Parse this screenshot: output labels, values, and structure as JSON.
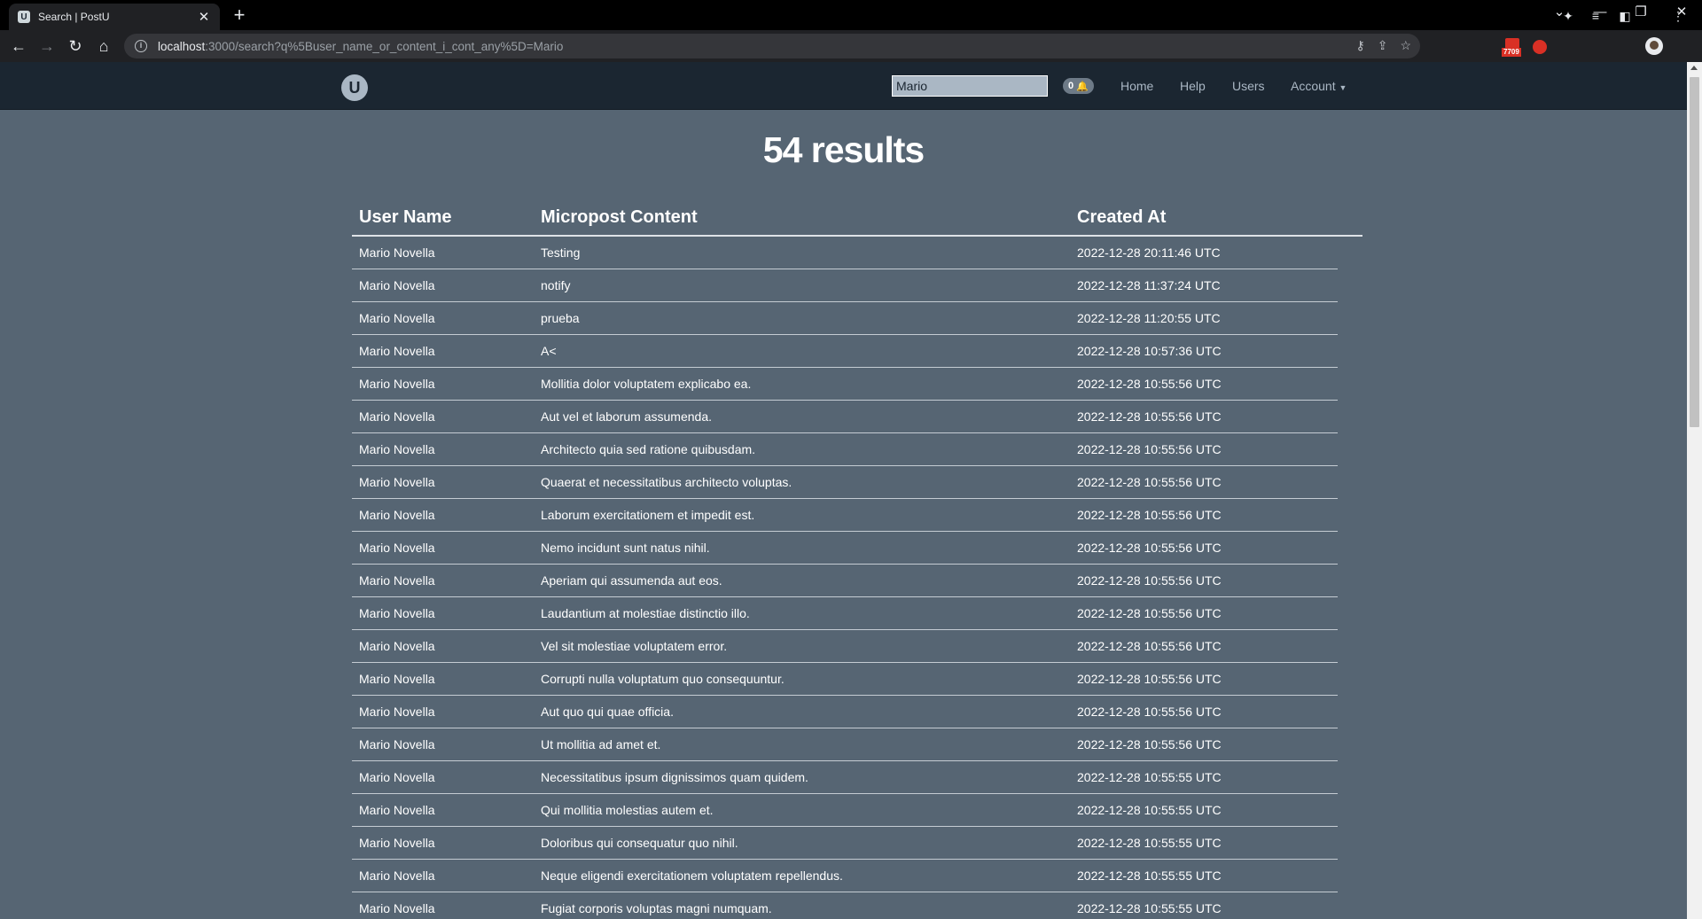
{
  "browser": {
    "tab_title": "Search | PostU",
    "tab_favicon": "U",
    "new_tab_symbol": "+",
    "url_host": "localhost",
    "url_rest": ":3000/search?q%5Buser_name_or_content_i_cont_any%5D=Mario",
    "extension_badge_count": "7709"
  },
  "navbar": {
    "logo_letter": "U",
    "search_value": "Mario",
    "notification_count": "0",
    "links": [
      "Home",
      "Help",
      "Users",
      "Account"
    ]
  },
  "results": {
    "title": "54 results",
    "headers": [
      "User Name",
      "Micropost Content",
      "Created At"
    ],
    "rows": [
      {
        "user": "Mario Novella",
        "content": "Testing",
        "created": "2022-12-28 20:11:46 UTC"
      },
      {
        "user": "Mario Novella",
        "content": "notify",
        "created": "2022-12-28 11:37:24 UTC"
      },
      {
        "user": "Mario Novella",
        "content": "prueba",
        "created": "2022-12-28 11:20:55 UTC"
      },
      {
        "user": "Mario Novella",
        "content": "A<",
        "created": "2022-12-28 10:57:36 UTC"
      },
      {
        "user": "Mario Novella",
        "content": "Mollitia dolor voluptatem explicabo ea.",
        "created": "2022-12-28 10:55:56 UTC"
      },
      {
        "user": "Mario Novella",
        "content": "Aut vel et laborum assumenda.",
        "created": "2022-12-28 10:55:56 UTC"
      },
      {
        "user": "Mario Novella",
        "content": "Architecto quia sed ratione quibusdam.",
        "created": "2022-12-28 10:55:56 UTC"
      },
      {
        "user": "Mario Novella",
        "content": "Quaerat et necessitatibus architecto voluptas.",
        "created": "2022-12-28 10:55:56 UTC"
      },
      {
        "user": "Mario Novella",
        "content": "Laborum exercitationem et impedit est.",
        "created": "2022-12-28 10:55:56 UTC"
      },
      {
        "user": "Mario Novella",
        "content": "Nemo incidunt sunt natus nihil.",
        "created": "2022-12-28 10:55:56 UTC"
      },
      {
        "user": "Mario Novella",
        "content": "Aperiam qui assumenda aut eos.",
        "created": "2022-12-28 10:55:56 UTC"
      },
      {
        "user": "Mario Novella",
        "content": "Laudantium at molestiae distinctio illo.",
        "created": "2022-12-28 10:55:56 UTC"
      },
      {
        "user": "Mario Novella",
        "content": "Vel sit molestiae voluptatem error.",
        "created": "2022-12-28 10:55:56 UTC"
      },
      {
        "user": "Mario Novella",
        "content": "Corrupti nulla voluptatum quo consequuntur.",
        "created": "2022-12-28 10:55:56 UTC"
      },
      {
        "user": "Mario Novella",
        "content": "Aut quo qui quae officia.",
        "created": "2022-12-28 10:55:56 UTC"
      },
      {
        "user": "Mario Novella",
        "content": "Ut mollitia ad amet et.",
        "created": "2022-12-28 10:55:56 UTC"
      },
      {
        "user": "Mario Novella",
        "content": "Necessitatibus ipsum dignissimos quam quidem.",
        "created": "2022-12-28 10:55:55 UTC"
      },
      {
        "user": "Mario Novella",
        "content": "Qui mollitia molestias autem et.",
        "created": "2022-12-28 10:55:55 UTC"
      },
      {
        "user": "Mario Novella",
        "content": "Doloribus qui consequatur quo nihil.",
        "created": "2022-12-28 10:55:55 UTC"
      },
      {
        "user": "Mario Novella",
        "content": "Neque eligendi exercitationem voluptatem repellendus.",
        "created": "2022-12-28 10:55:55 UTC"
      },
      {
        "user": "Mario Novella",
        "content": "Fugiat corporis voluptas magni numquam.",
        "created": "2022-12-28 10:55:55 UTC"
      }
    ]
  },
  "colors": {
    "page_bg": "#566573",
    "navbar_bg": "#1b2631",
    "search_bg": "#aab7c4"
  }
}
